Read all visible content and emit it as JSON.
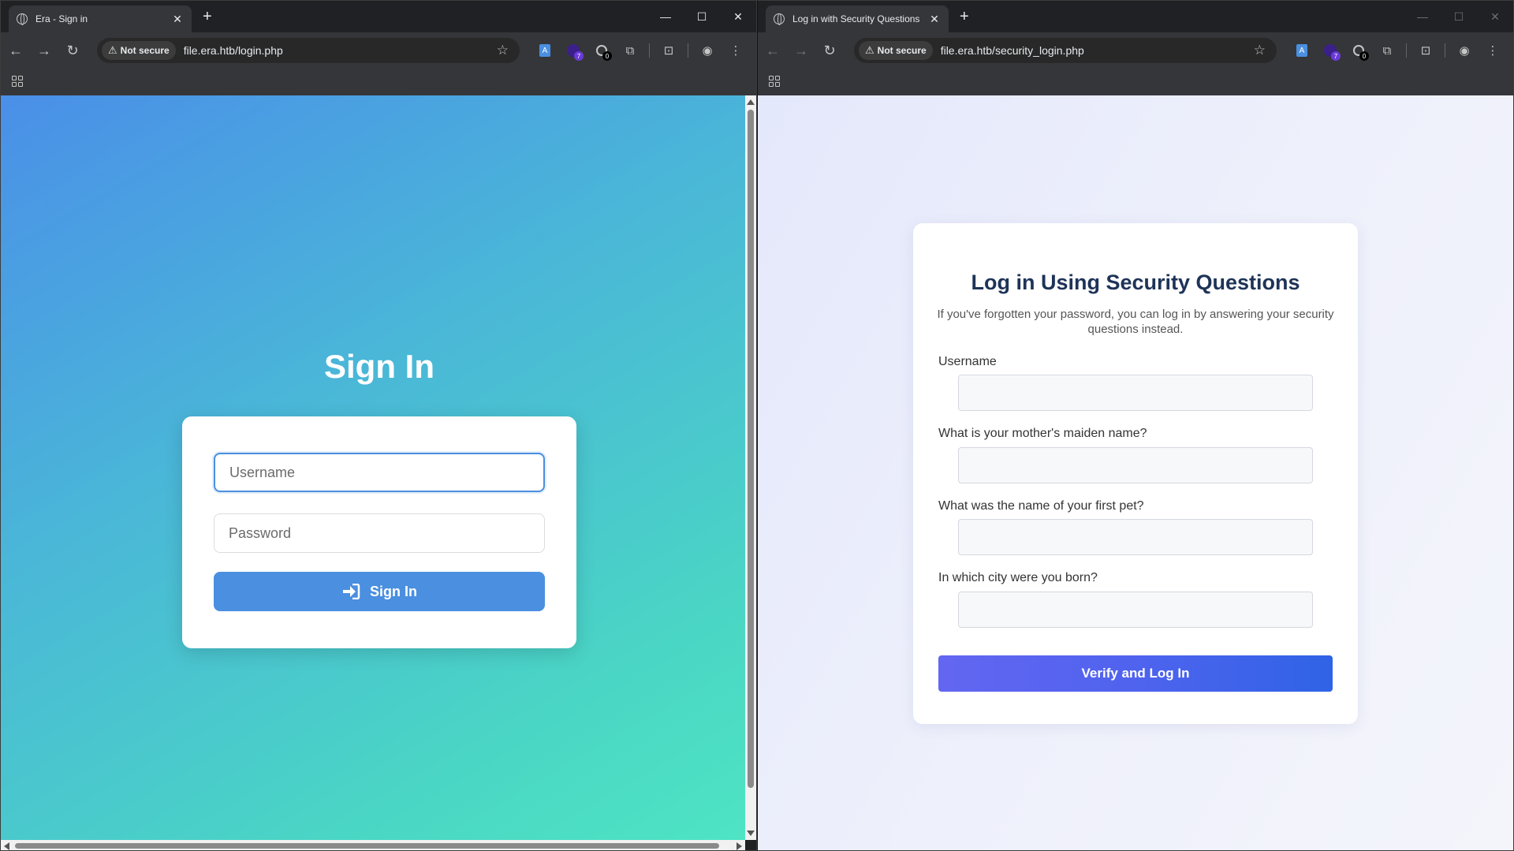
{
  "left": {
    "tab_title": "Era - Sign in",
    "secure_label": "Not secure",
    "url": "file.era.htb/login.php",
    "heading": "Sign In",
    "username_placeholder": "Username",
    "password_placeholder": "Password",
    "signin_label": "Sign In",
    "ext_badges": [
      "7",
      "0"
    ]
  },
  "right": {
    "tab_title": "Log in with Security Questions",
    "secure_label": "Not secure",
    "url": "file.era.htb/security_login.php",
    "heading": "Log in Using Security Questions",
    "subtitle": "If you've forgotten your password, you can log in by answering your security questions instead.",
    "fields": [
      {
        "label": "Username"
      },
      {
        "label": "What is your mother's maiden name?"
      },
      {
        "label": "What was the name of your first pet?"
      },
      {
        "label": "In which city were you born?"
      }
    ],
    "submit_label": "Verify and Log In",
    "ext_badges": [
      "7",
      "0"
    ]
  },
  "colors": {
    "accent_blue": "#4a8fe0",
    "button_gradient_start": "#6366f1",
    "button_gradient_end": "#2f63e6",
    "heading_navy": "#1e3358"
  }
}
